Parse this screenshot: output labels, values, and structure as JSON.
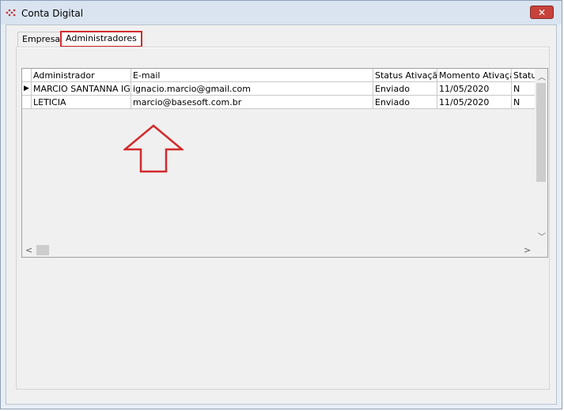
{
  "window": {
    "title": "Conta Digital",
    "close_glyph": "✕"
  },
  "tabs": [
    {
      "label": "Empresa"
    },
    {
      "label": "Administradores",
      "active": true
    }
  ],
  "grid": {
    "columns": [
      "Administrador",
      "E-mail",
      "Status Ativação",
      "Momento Ativação",
      "Status"
    ],
    "rows": [
      [
        "MARCIO SANTANNA IGNACIO",
        "ignacio.marcio@gmail.com",
        "Enviado",
        "11/05/2020",
        "N"
      ],
      [
        "LETICIA",
        "marcio@basesoft.com.br",
        "Enviado",
        "11/05/2020",
        "N"
      ]
    ],
    "current_row_marker": "▶"
  },
  "annotation": {
    "color": "#d42a2a",
    "icon": "red-up-arrow-outline"
  },
  "colors": {
    "tab_highlight": "#d42a2a",
    "close_button": "#c7423a"
  }
}
